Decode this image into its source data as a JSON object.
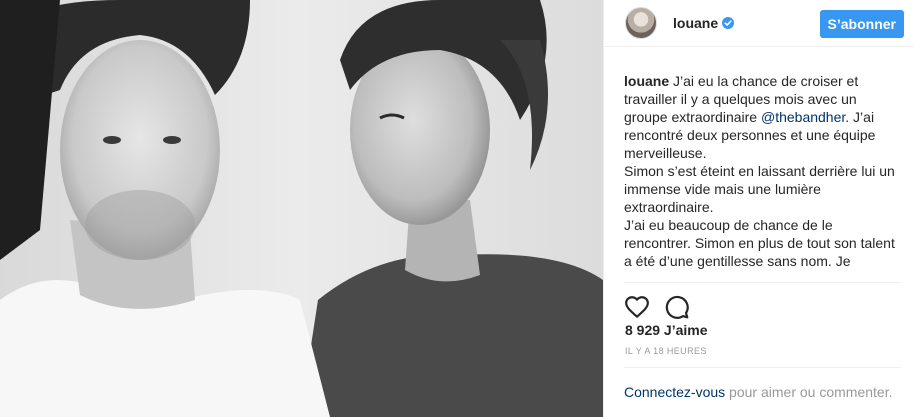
{
  "post": {
    "username": "louane",
    "follow_label": "S’abonner",
    "caption": {
      "author": "louane",
      "part1": " J’ai eu la chance de croiser et travailler il y a quelques mois avec un groupe extraordinaire ",
      "mention": "@thebandher",
      "part2": ". J’ai rencontré deux personnes et une équipe merveilleuse.",
      "line2": "Simon s’est éteint en laissant derrière lui un immense vide mais une lumière extraordinaire.",
      "line3": "J’ai eu beaucoup de chance de le rencontrer. Simon en plus de tout son talent a été d’une gentillesse sans nom. Je"
    },
    "likes": "8 929 J’aime",
    "timestamp": "IL Y A 18 HEURES",
    "login_link": "Connectez-vous",
    "login_text": " pour aimer ou commenter."
  },
  "icons": {
    "avatar": "avatar-photo",
    "verified": "verified-badge-icon",
    "like": "heart-icon",
    "comment": "comment-bubble-icon"
  },
  "colors": {
    "accent": "#3897f0",
    "link": "#003569",
    "muted": "#999999",
    "text": "#262626"
  }
}
